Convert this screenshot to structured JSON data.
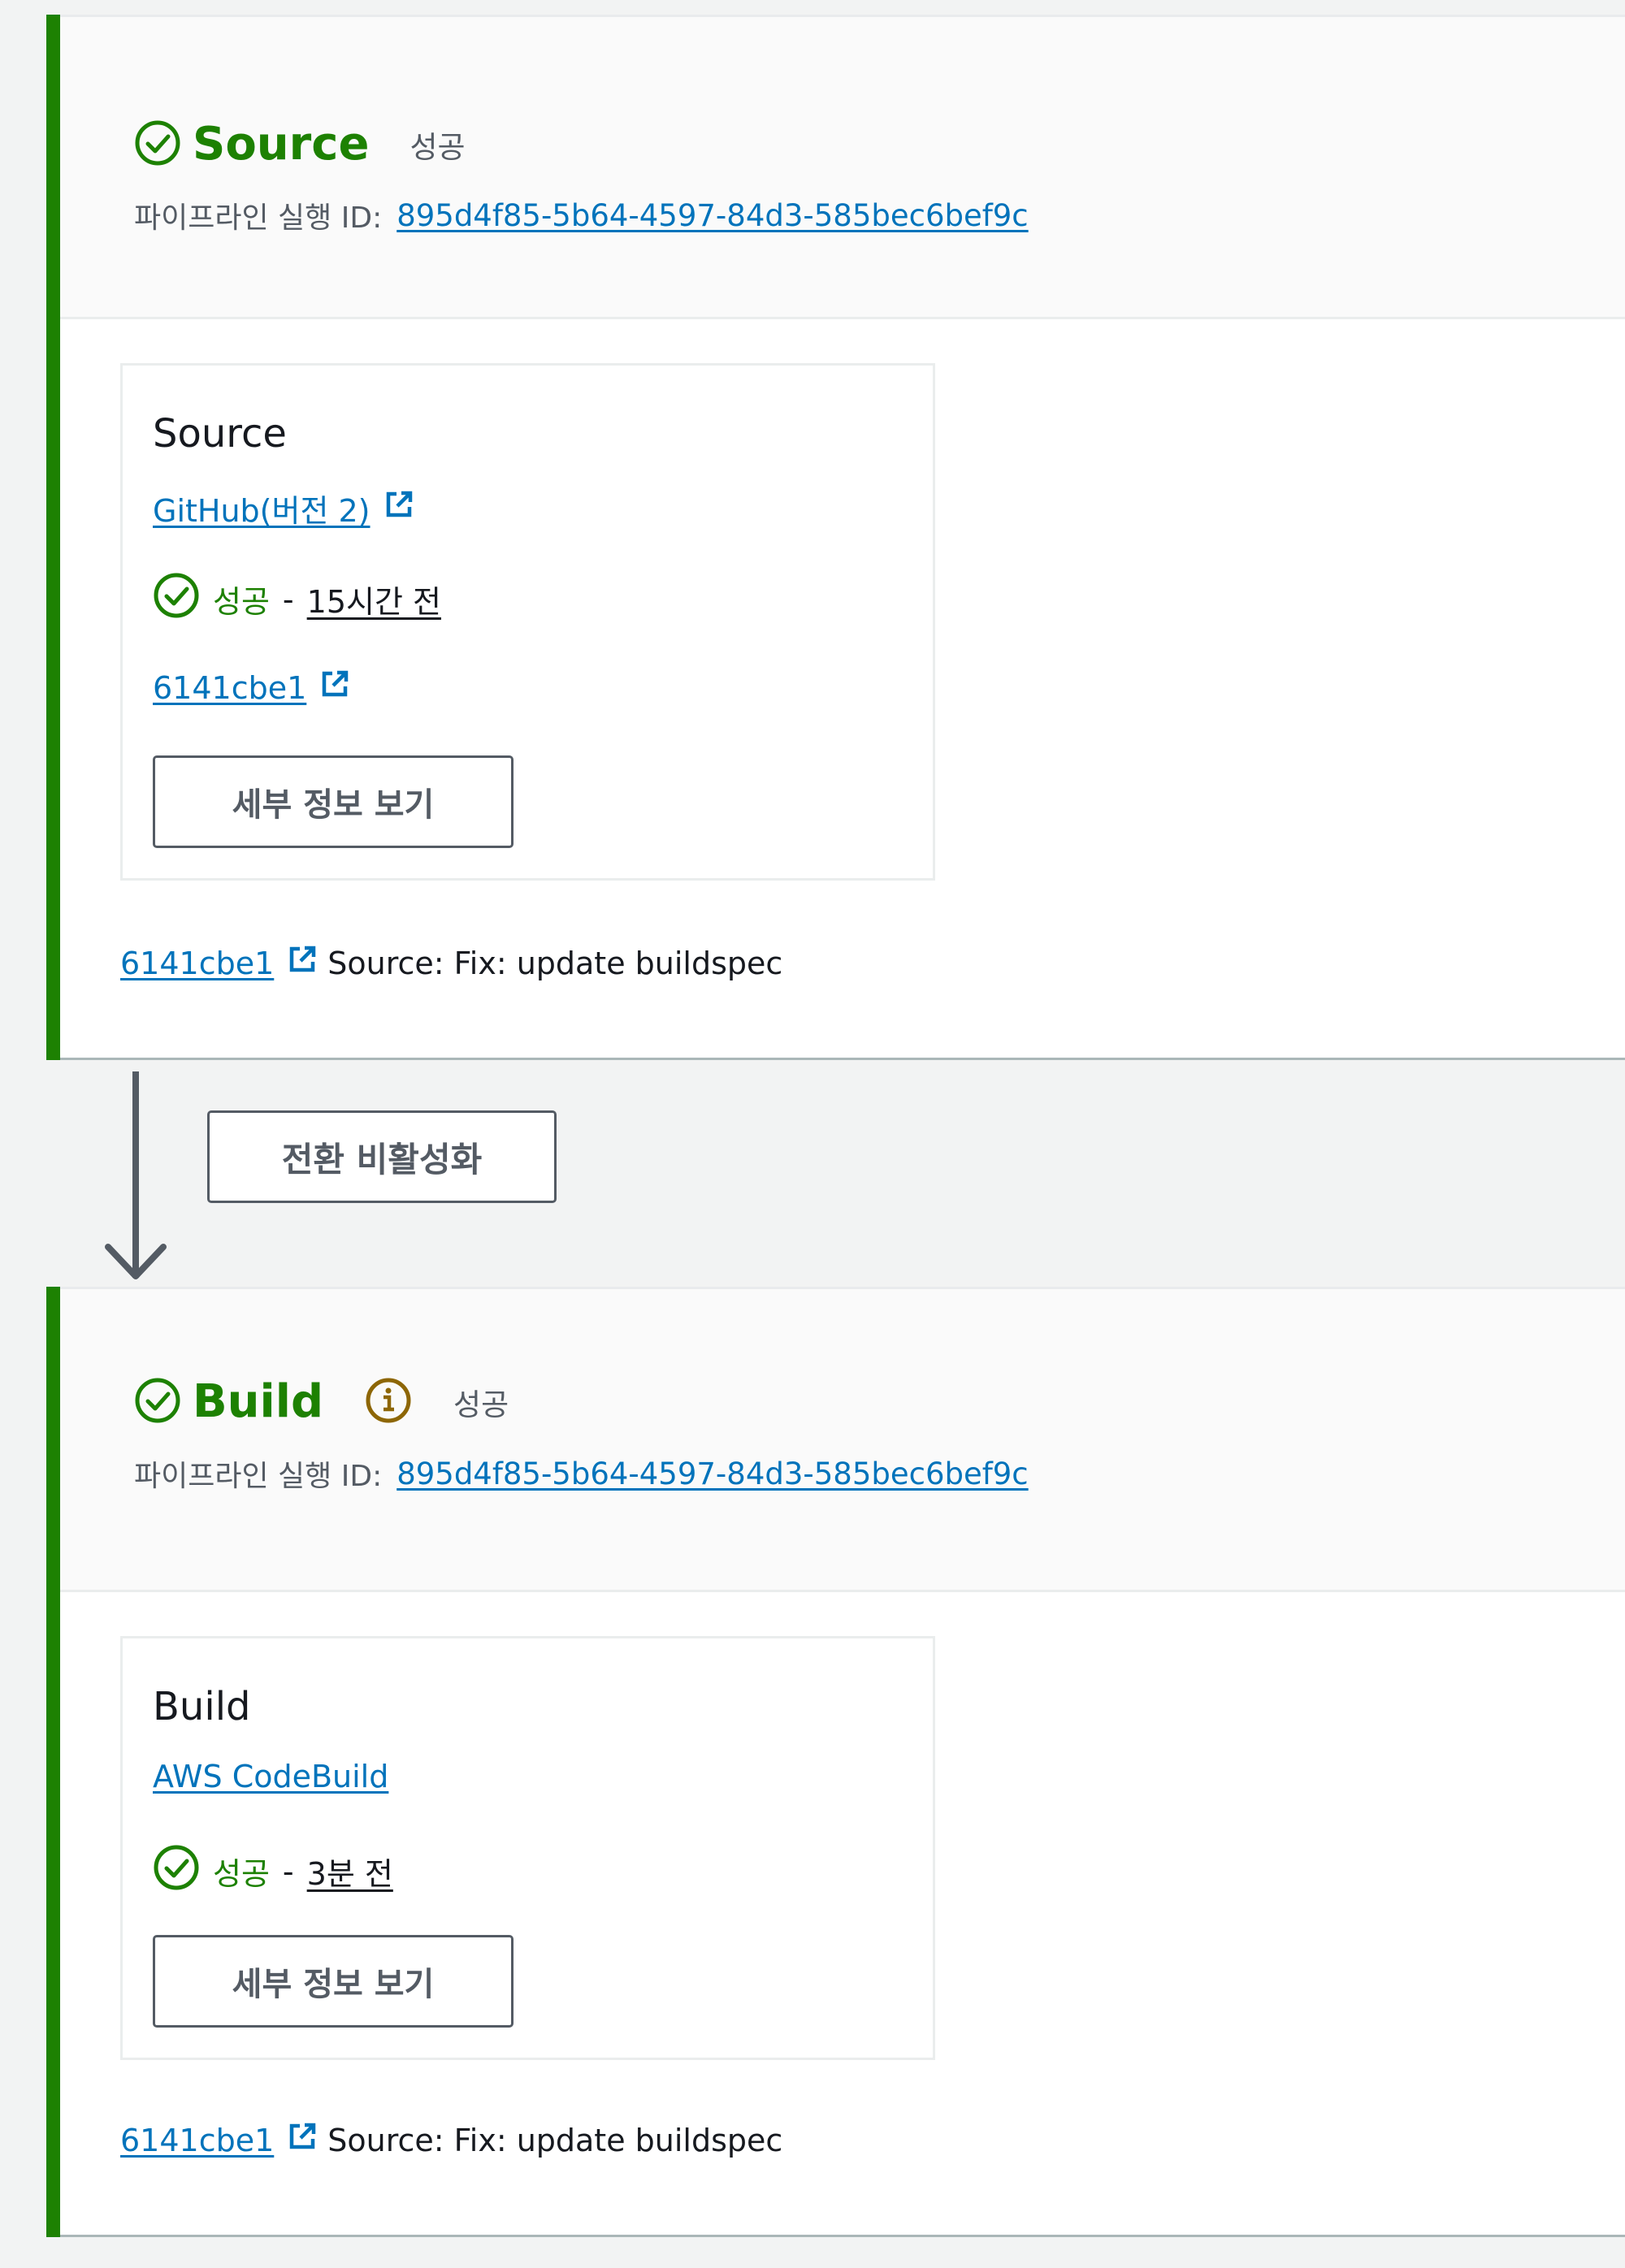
{
  "colors": {
    "success": "#1d8102",
    "link": "#0073bb",
    "info": "#8d6605",
    "text": "#16191f",
    "muted": "#545b64"
  },
  "stages": [
    {
      "title": "Source",
      "status": "성공",
      "has_info_icon": false,
      "execution_label": "파이프라인 실행 ID:",
      "execution_id": "895d4f85-5b64-4597-84d3-585bec6bef9c",
      "action": {
        "name": "Source",
        "provider": "GitHub(버전 2)",
        "provider_external": true,
        "status": "성공",
        "separator": "-",
        "time": "15시간 전",
        "commit": "6141cbe1",
        "details_button": "세부 정보 보기"
      },
      "footer_commit": "6141cbe1",
      "footer_message": "Source: Fix: update buildspec"
    },
    {
      "title": "Build",
      "status": "성공",
      "has_info_icon": true,
      "execution_label": "파이프라인 실행 ID:",
      "execution_id": "895d4f85-5b64-4597-84d3-585bec6bef9c",
      "action": {
        "name": "Build",
        "provider": "AWS CodeBuild",
        "provider_external": false,
        "status": "성공",
        "separator": "-",
        "time": "3분 전",
        "details_button": "세부 정보 보기"
      },
      "footer_commit": "6141cbe1",
      "footer_message": "Source: Fix: update buildspec"
    }
  ],
  "transition": {
    "button_label": "전환 비활성화"
  },
  "icons": {
    "success": "check-circle-icon",
    "external": "external-link-icon",
    "info": "info-circle-icon",
    "arrow": "arrow-down-icon"
  }
}
